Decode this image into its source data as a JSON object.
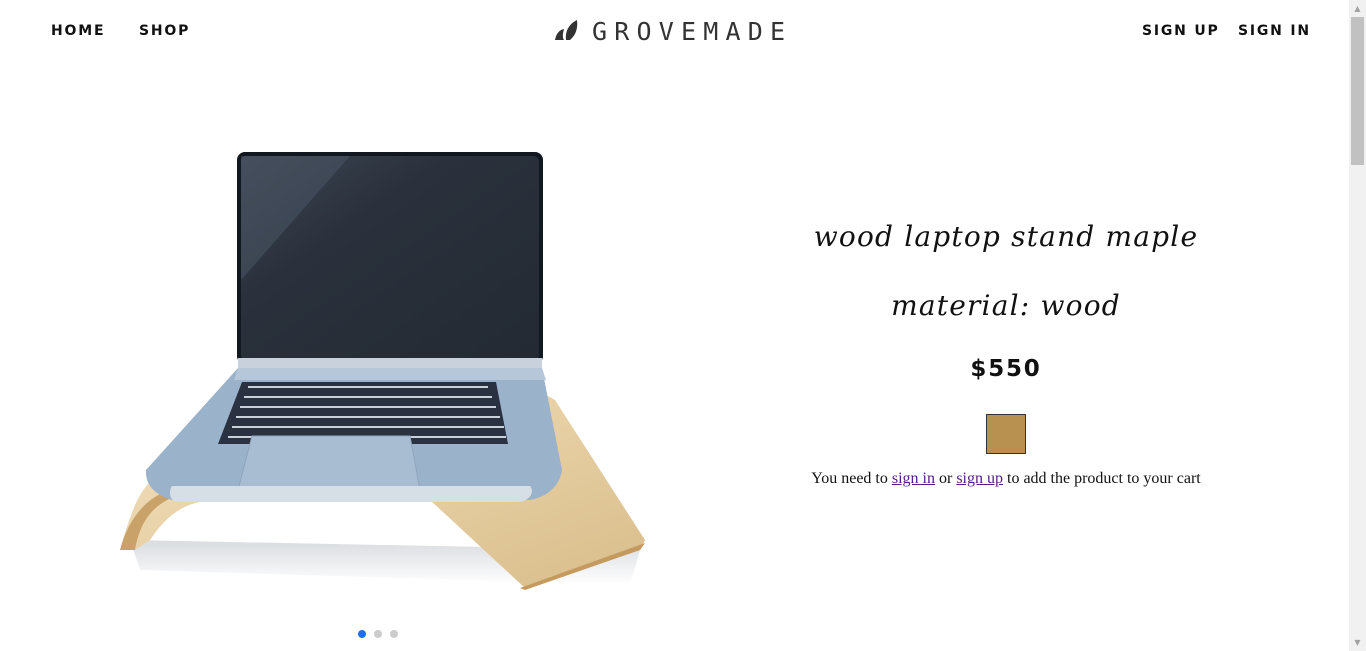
{
  "nav": {
    "left": [
      "HOME",
      "SHOP"
    ],
    "right": [
      "SIGN UP",
      "SIGN IN"
    ]
  },
  "brand": {
    "name": "GROVEMADE"
  },
  "product": {
    "title": "wood laptop stand maple",
    "material": "material: wood",
    "price": "$550",
    "swatch_color": "#b89150",
    "image_icon": "laptop-on-wood-stand",
    "gallery_total": 3,
    "gallery_active": 1
  },
  "cart_note": {
    "prefix": "You need to ",
    "sign_in": "sign in",
    "or": " or ",
    "sign_up": "sign up",
    "suffix": " to add the product to your cart"
  },
  "colors": {
    "accent": "#1a73e8",
    "link_visited": "#551a8b",
    "text": "#111111"
  }
}
